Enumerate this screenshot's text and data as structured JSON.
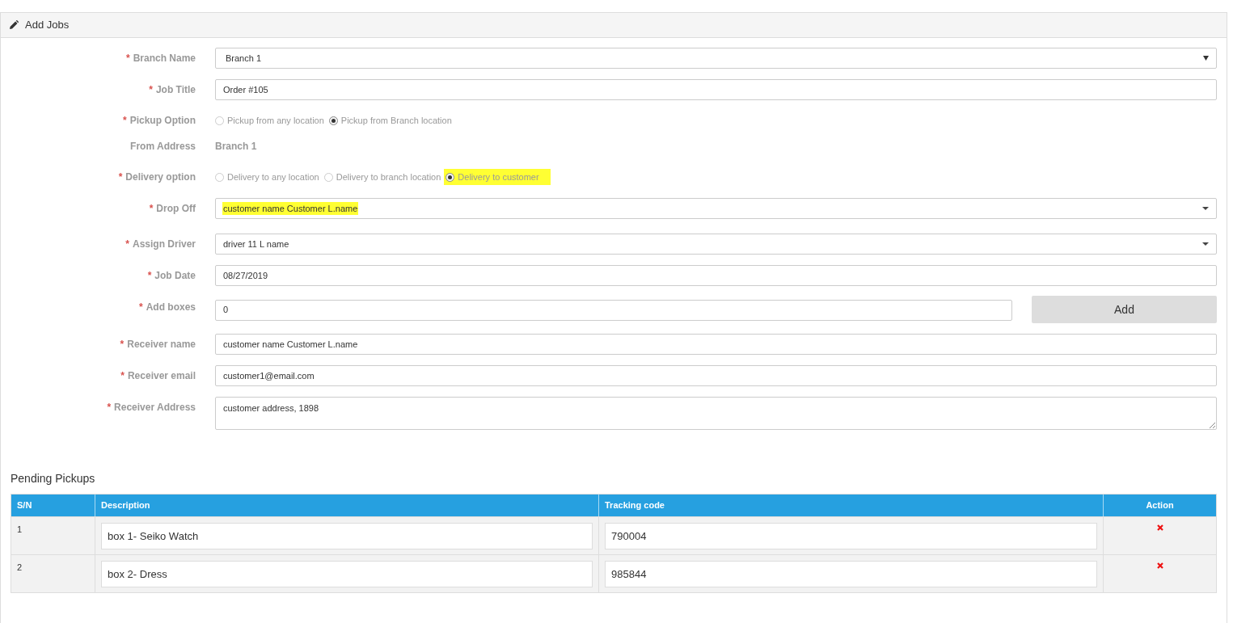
{
  "panel": {
    "title": "Add Jobs"
  },
  "fields": [
    {
      "kind": "select",
      "mark": "*",
      "label": "Branch Name",
      "value": "Branch 1",
      "highlighted": false
    },
    {
      "kind": "input",
      "mark": "*",
      "label": "Job Title",
      "value": "Order #105"
    },
    {
      "kind": "radio",
      "mark": "*",
      "label": "Pickup Option",
      "options": [
        {
          "label": "Pickup from any location",
          "selected": false,
          "highlighted": false
        },
        {
          "label": "Pickup from Branch location",
          "selected": true,
          "highlighted": false
        }
      ]
    },
    {
      "kind": "static",
      "label": "From Address",
      "value": "Branch 1"
    },
    {
      "kind": "radio",
      "mark": "*",
      "label": "Delivery option",
      "options": [
        {
          "label": "Delivery to any location",
          "selected": false,
          "highlighted": false
        },
        {
          "label": "Delivery to branch location",
          "selected": false,
          "highlighted": false
        },
        {
          "label": "Delivery to customer",
          "selected": true,
          "highlighted": true
        }
      ]
    },
    {
      "kind": "combo",
      "mark": "*",
      "label": "Drop Off",
      "value": "customer name Customer L.name",
      "highlighted": true
    },
    {
      "kind": "combo",
      "mark": "*",
      "label": "Assign Driver",
      "value": "driver 11 L name",
      "highlighted": false
    },
    {
      "kind": "input",
      "mark": "*",
      "label": "Job Date",
      "value": "08/27/2019"
    },
    {
      "kind": "input_button",
      "mark": "*",
      "label": "Add boxes",
      "value": "0",
      "button": "Add"
    },
    {
      "kind": "input",
      "mark": "*",
      "label": "Receiver name",
      "value": "customer name Customer L.name"
    },
    {
      "kind": "input",
      "mark": "*",
      "label": "Receiver email",
      "value": "customer1@email.com"
    },
    {
      "kind": "textarea",
      "mark": "*",
      "label": "Receiver Address",
      "value": "customer address, 1898"
    }
  ],
  "pending": {
    "title": "Pending Pickups",
    "columns": [
      "S/N",
      "Description",
      "Tracking code",
      "Action"
    ],
    "rows": [
      {
        "sn": "1",
        "description": "box 1- Seiko Watch",
        "tracking": "790004"
      },
      {
        "sn": "2",
        "description": "box 2- Dress",
        "tracking": "985844"
      }
    ]
  }
}
